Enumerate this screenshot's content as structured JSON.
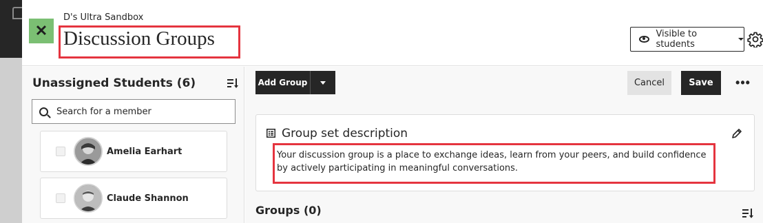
{
  "header": {
    "course_name": "D's Ultra Sandbox",
    "title": "Discussion Groups",
    "close_icon": "close-icon",
    "visibility_label": "Visible to students",
    "settings_icon": "gear-icon"
  },
  "left": {
    "title": "Unassigned Students (6)",
    "search_placeholder": "Search for a member",
    "students": [
      {
        "name": "Amelia Earhart"
      },
      {
        "name": "Claude Shannon"
      }
    ]
  },
  "right": {
    "add_group_label": "Add Group",
    "cancel_label": "Cancel",
    "save_label": "Save",
    "more_label": "•••",
    "description": {
      "title": "Group set description",
      "text": "Your discussion group is a place to exchange ideas, learn from your peers, and build confidence by actively participating in meaningful conversations."
    },
    "groups_title": "Groups (0)"
  },
  "colors": {
    "highlight": "#e5343f",
    "close_bg": "#7bbf73",
    "primary_button": "#262626"
  }
}
